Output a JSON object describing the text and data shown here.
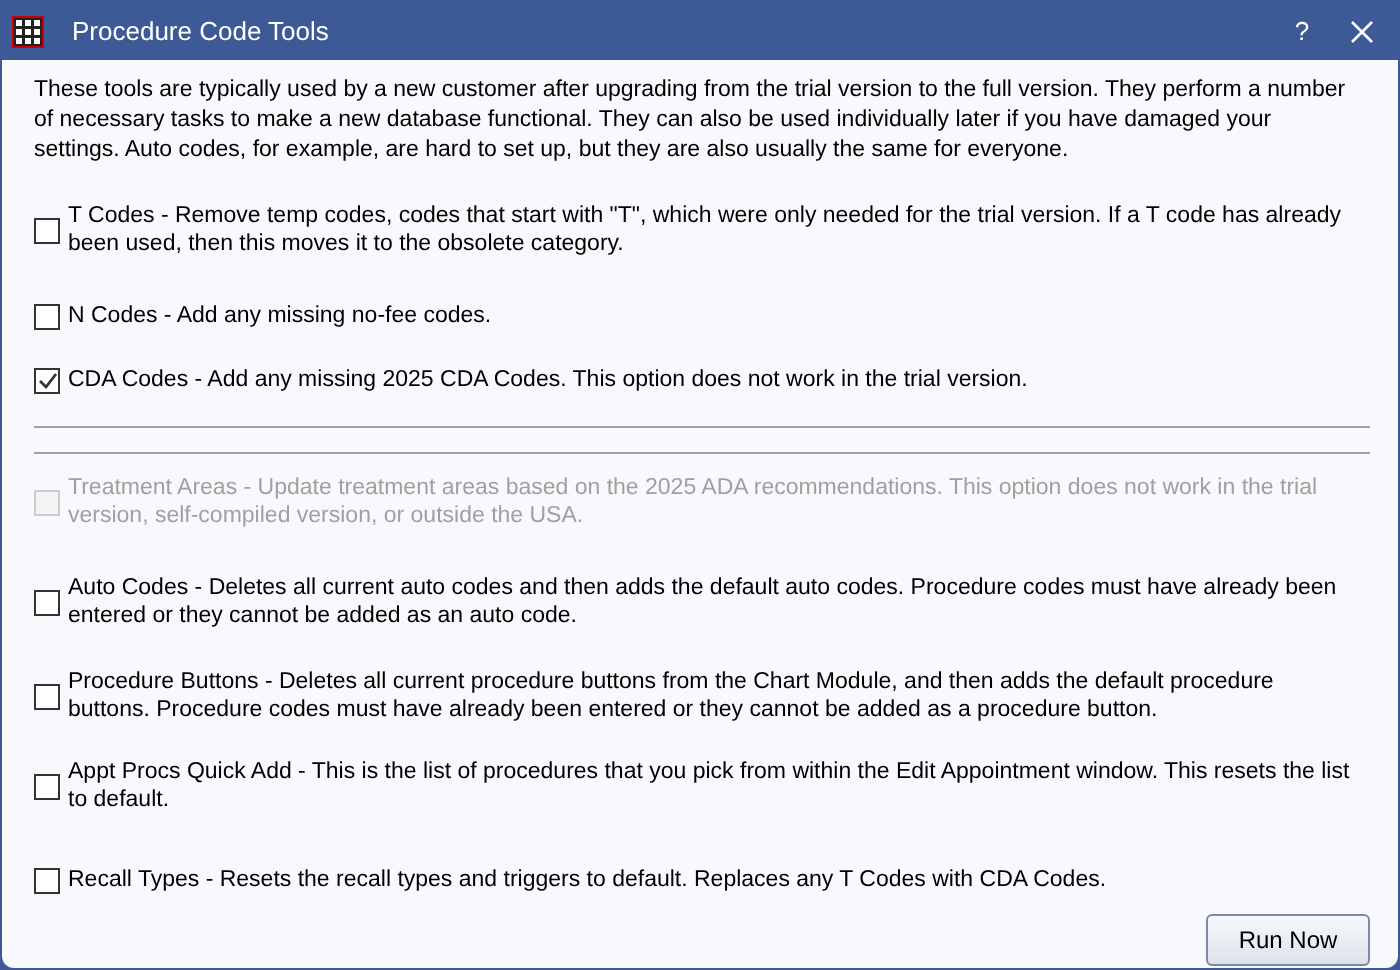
{
  "window": {
    "title": "Procedure Code Tools",
    "help": "?"
  },
  "intro": "These tools are typically used by a new customer after upgrading from the trial version to the full version. They perform a number of necessary tasks to make a new database functional. They can also be used individually later if you have damaged your settings. Auto codes, for example, are hard to set up, but they are also usually the same for everyone.",
  "items": [
    {
      "kind": "option",
      "label": "T Codes - Remove temp codes, codes that start with \"T\", which were only needed for the trial version. If a T code has already been used, then this moves it to the obsolete category.",
      "checked": false,
      "disabled": false
    },
    {
      "kind": "option",
      "label": "N Codes - Add any missing no-fee codes.",
      "checked": false,
      "disabled": false
    },
    {
      "kind": "option",
      "label": "CDA Codes - Add any missing 2025 CDA Codes. This option does not work in the trial version.",
      "checked": true,
      "disabled": false
    },
    {
      "kind": "separator"
    },
    {
      "kind": "separator"
    },
    {
      "kind": "option",
      "label": "Treatment Areas - Update treatment areas based on the 2025 ADA recommendations. This option does not work in the trial version, self-compiled version, or outside the USA.",
      "checked": false,
      "disabled": true
    },
    {
      "kind": "option",
      "label": "Auto Codes - Deletes all current auto codes and then adds the default auto codes. Procedure codes must have already been entered or they cannot be added as an auto code.",
      "checked": false,
      "disabled": false
    },
    {
      "kind": "option",
      "label": "Procedure Buttons - Deletes all current procedure buttons from the Chart Module, and then adds the default procedure buttons. Procedure codes must have already been entered or they cannot be added as a procedure button.",
      "checked": false,
      "disabled": false
    },
    {
      "kind": "option",
      "label": "Appt Procs Quick Add - This is the list of procedures that you pick from within the Edit Appointment window. This resets the list to default.",
      "checked": false,
      "disabled": false
    },
    {
      "kind": "option",
      "label": "Recall Types - Resets the recall types and triggers to default. Replaces any T Codes with CDA Codes.",
      "checked": false,
      "disabled": false
    }
  ],
  "buttons": [
    "Run Now"
  ]
}
